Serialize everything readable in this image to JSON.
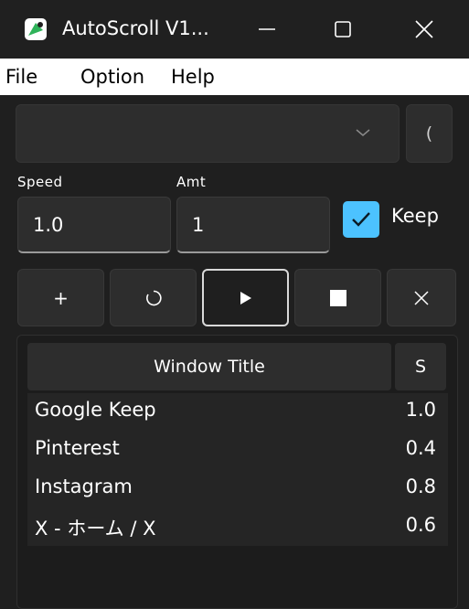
{
  "window": {
    "title": "AutoScroll V1...",
    "icon": "app-logo-icon",
    "controls": [
      "minimize-icon",
      "maximize-icon",
      "close-icon"
    ]
  },
  "menu": {
    "file": "File",
    "option": "Option",
    "help": "Help"
  },
  "top": {
    "combo_value": "",
    "side_button_label": "("
  },
  "fields": {
    "speed_label": "Speed",
    "speed_value": "1.0",
    "amt_label": "Amt",
    "amt_value": "1",
    "keep_label": "Keep",
    "keep_checked": true
  },
  "toolbar": {
    "add_label": "+",
    "buttons": [
      "add",
      "refresh-icon",
      "play-icon",
      "stop-icon",
      "close-icon"
    ]
  },
  "table": {
    "columns": [
      "Window Title",
      "S"
    ],
    "rows": [
      {
        "title": "Google Keep",
        "speed": "1.0"
      },
      {
        "title": "Pinterest",
        "speed": "0.4"
      },
      {
        "title": "Instagram",
        "speed": "0.8"
      },
      {
        "title": "X - ホーム / X",
        "speed": "0.6"
      }
    ]
  },
  "colors": {
    "background": "#1f1f1f",
    "accent": "#4cc2ff",
    "panel": "#2d2d2d"
  }
}
